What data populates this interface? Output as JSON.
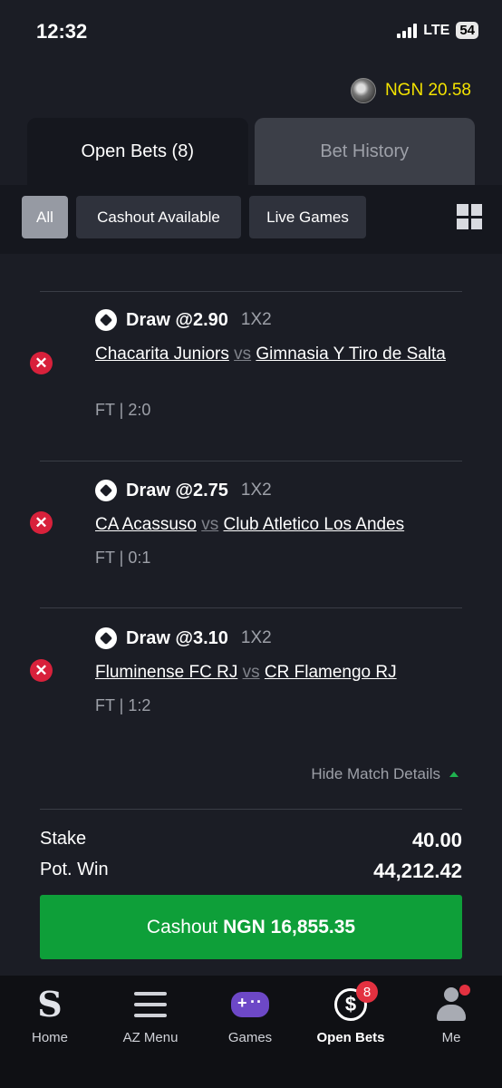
{
  "status_bar": {
    "time": "12:32",
    "network": "LTE",
    "battery": "54"
  },
  "header": {
    "balance": "NGN 20.58"
  },
  "tabs": [
    {
      "label": "Open Bets (8)",
      "active": true
    },
    {
      "label": "Bet History",
      "active": false
    }
  ],
  "filters": [
    {
      "label": "All",
      "active": true
    },
    {
      "label": "Cashout Available",
      "active": false
    },
    {
      "label": "Live Games",
      "active": false
    }
  ],
  "selections": [
    {
      "pick": "Draw @2.90",
      "market": "1X2",
      "home": "Chacarita Juniors",
      "vs": "vs",
      "away": "Gimnasia Y Tiro de Salta",
      "result": "FT | 2:0",
      "status": "lost"
    },
    {
      "pick": "Draw @2.75",
      "market": "1X2",
      "home": "CA Acassuso",
      "vs": "vs",
      "away": "Club Atletico Los Andes",
      "result": "FT | 0:1",
      "status": "lost"
    },
    {
      "pick": "Draw @3.10",
      "market": "1X2",
      "home": "Fluminense FC RJ",
      "vs": "vs",
      "away": "CR Flamengo RJ",
      "result": "FT | 1:2",
      "status": "lost"
    }
  ],
  "details_toggle": "Hide Match Details",
  "summary": {
    "stake_label": "Stake",
    "stake_value": "40.00",
    "potwin_label": "Pot. Win",
    "potwin_value": "44,212.42"
  },
  "cashout": {
    "label": "Cashout",
    "amount": "NGN 16,855.35"
  },
  "bottom_nav": [
    {
      "label": "Home",
      "icon": "sportybet-logo-icon"
    },
    {
      "label": "AZ Menu",
      "icon": "menu-icon"
    },
    {
      "label": "Games",
      "icon": "gamepad-icon"
    },
    {
      "label": "Open Bets",
      "icon": "open-bets-icon",
      "badge": "8",
      "active": true
    },
    {
      "label": "Me",
      "icon": "user-icon"
    }
  ],
  "colors": {
    "accent_green": "#0e9f39",
    "balance_yellow": "#f4e300",
    "lost_red": "#d8213b"
  }
}
